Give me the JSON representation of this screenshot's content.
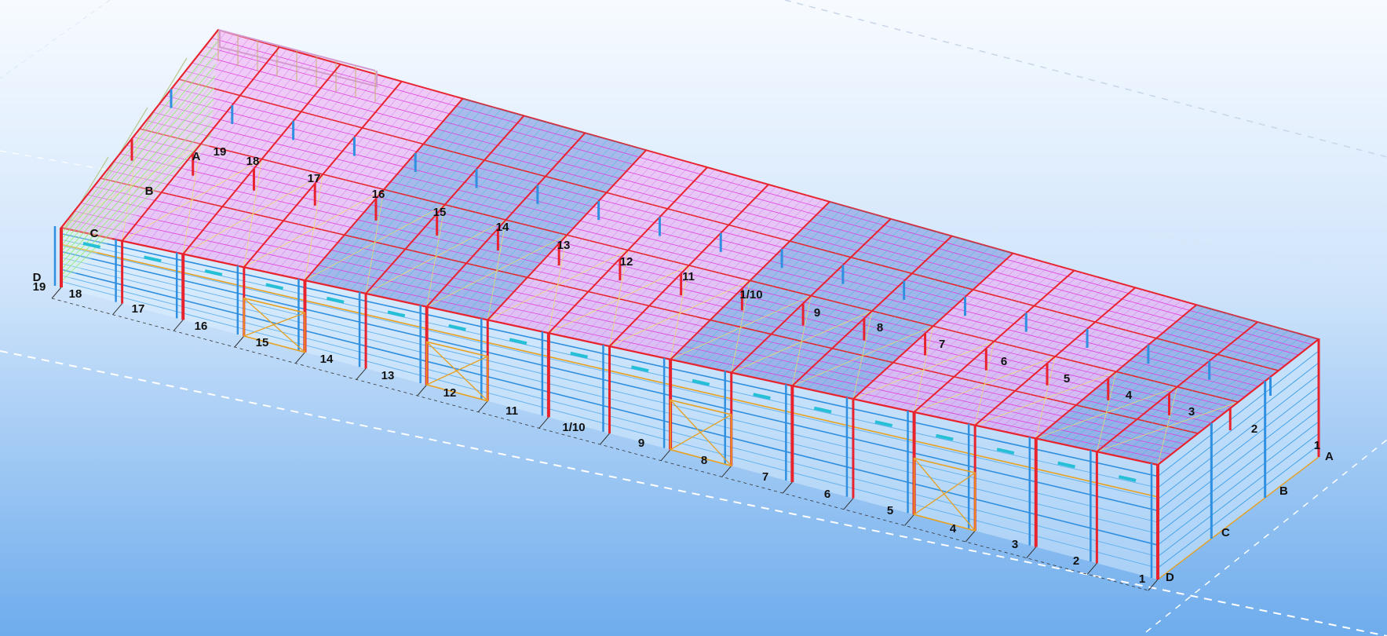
{
  "colors": {
    "bg_top": "#f7fbff",
    "bg_bottom": "#6eacec",
    "frame_red": "#e8232e",
    "column_blue": "#2f8fe0",
    "purlin_cyan": "#25c0d6",
    "roof_magenta": "#e23ee0",
    "roof_fill": "#f2a8f0",
    "girt_green": "#8ff06a",
    "bracing_orange": "#e8a020",
    "grid_dash": "#ffffff",
    "label": "#111111"
  },
  "grid_labels": {
    "front_axes": [
      "19",
      "18",
      "17",
      "16",
      "15",
      "14",
      "13",
      "12",
      "11",
      "1/10",
      "9",
      "8",
      "7",
      "6",
      "5",
      "4",
      "3",
      "2",
      "1"
    ],
    "roof_axes": [
      "19",
      "18",
      "17",
      "16",
      "15",
      "14",
      "13",
      "12",
      "11",
      "1/10",
      "9",
      "8",
      "7",
      "6",
      "5",
      "4",
      "3",
      "2",
      "1"
    ],
    "left_rows": [
      "D",
      "C",
      "B",
      "A"
    ],
    "right_rows": [
      "A",
      "B",
      "C",
      "D"
    ]
  }
}
